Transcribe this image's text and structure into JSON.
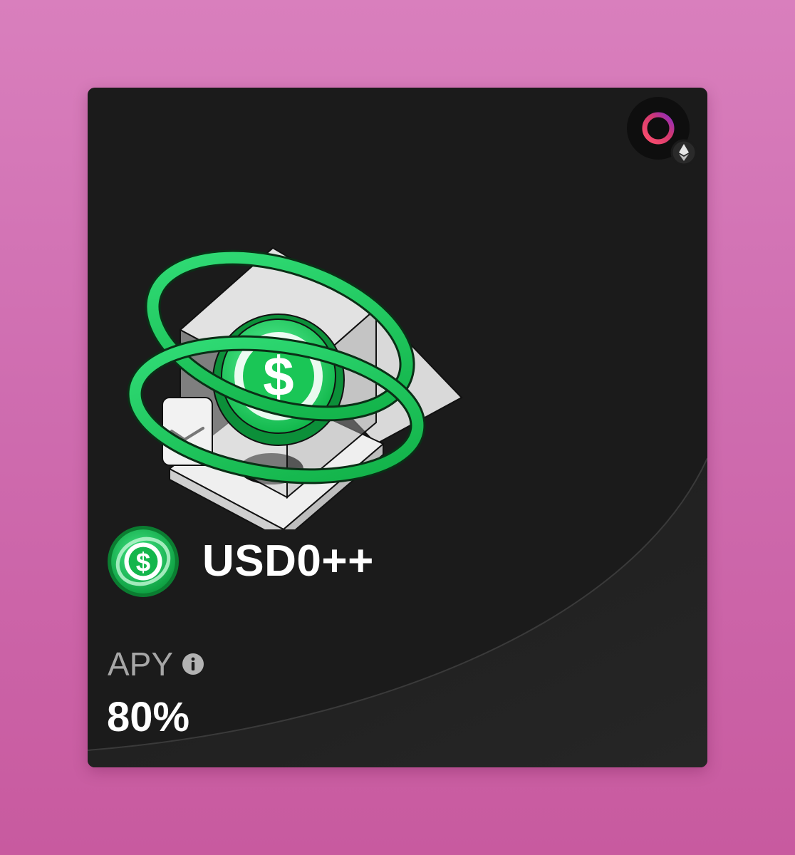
{
  "card": {
    "token": {
      "name": "USD0++",
      "icon": "usd0-coin-icon",
      "brand_color": "#19c24d"
    },
    "apy": {
      "label": "APY",
      "info_icon": "info-icon",
      "value": "80%"
    },
    "protocol_badge": {
      "icon": "protocol-ring-icon",
      "network_icon": "ethereum-icon"
    },
    "hero_illustration": "usd0-vault-illustration"
  },
  "colors": {
    "page_background": "#d27ab8",
    "card_background": "#1b1b1b",
    "accent_green": "#1fd35f",
    "label_gray": "#a6a6a6",
    "text_white": "#ffffff"
  }
}
